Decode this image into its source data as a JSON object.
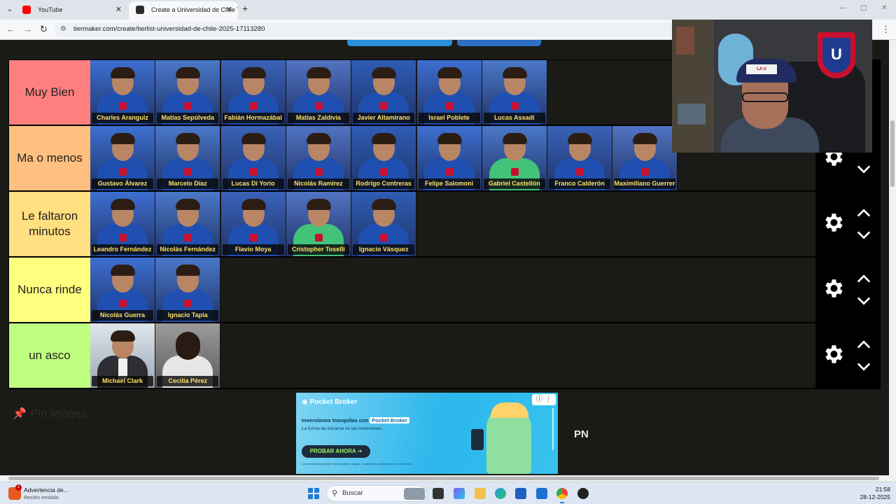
{
  "browser": {
    "tabs": [
      {
        "label": "YouTube"
      },
      {
        "label": "Create a Universidad de Chile T"
      }
    ],
    "new_tab": "+",
    "url": "tiermaker.com/create/tierlist-universidad-de-chile-2025-17113280",
    "controls": {
      "minimize": "—",
      "maximize": "▢",
      "close": "✕"
    }
  },
  "tiers": [
    {
      "label": "Muy Bien",
      "color": "#ff7f7f",
      "items": [
        "Charles Aranguiz",
        "Matías Sepúlveda",
        "Fabián Hormazábal",
        "Matías Zaldivia",
        "Javier Altamirano",
        "Israel Poblete",
        "Lucas Assadi"
      ]
    },
    {
      "label": "Ma o menos",
      "color": "#ffbf7f",
      "items": [
        "Gustavo Álvarez",
        "Marcelo Díaz",
        "Lucas Di Yorio",
        "Nicolás Ramírez",
        "Rodrigo Contreras",
        "Felipe Salomoni",
        "Gabriel Castellón",
        "Franco Calderón",
        "Maximiliano Guerrero"
      ]
    },
    {
      "label": "Le faltaron minutos",
      "color": "#ffdf7f",
      "items": [
        "Leandro Fernández",
        "Nicolás Fernández",
        "Flavio Moya",
        "Cristopher Toselli",
        "Ignacio Vásquez"
      ]
    },
    {
      "label": "Nunca rinde",
      "color": "#ffff7f",
      "items": [
        "Nicolás Guerra",
        "Ignacio Tapia"
      ]
    },
    {
      "label": "un asco",
      "color": "#bfff7f",
      "items": [
        "Michael Clark",
        "Cecilia Pérez"
      ]
    }
  ],
  "pin_images": {
    "label": "Pin Images",
    "icon": "pin-icon"
  },
  "ad": {
    "brand": "Pocket Broker",
    "line1_prefix": "Inversiones tranquilas con",
    "line1_brand": "Pocket Broker",
    "line2": "La forma de iniciarse en las inversiones.",
    "cta": "PROBAR AHORA",
    "fine": "Las inversiones pueden estar sujetas a riesgos. Consulte las condiciones en el sitio web.",
    "badge": "ⓘ ⋮"
  },
  "side_text": "PN",
  "cam": {
    "hat_text": "LA U"
  },
  "taskbar": {
    "notification_title": "Advertencia de...",
    "notification_sub": "Recién emitida",
    "notification_badge": "1",
    "search_placeholder": "Buscar",
    "time": "21:58",
    "date": "28-12-2025"
  }
}
